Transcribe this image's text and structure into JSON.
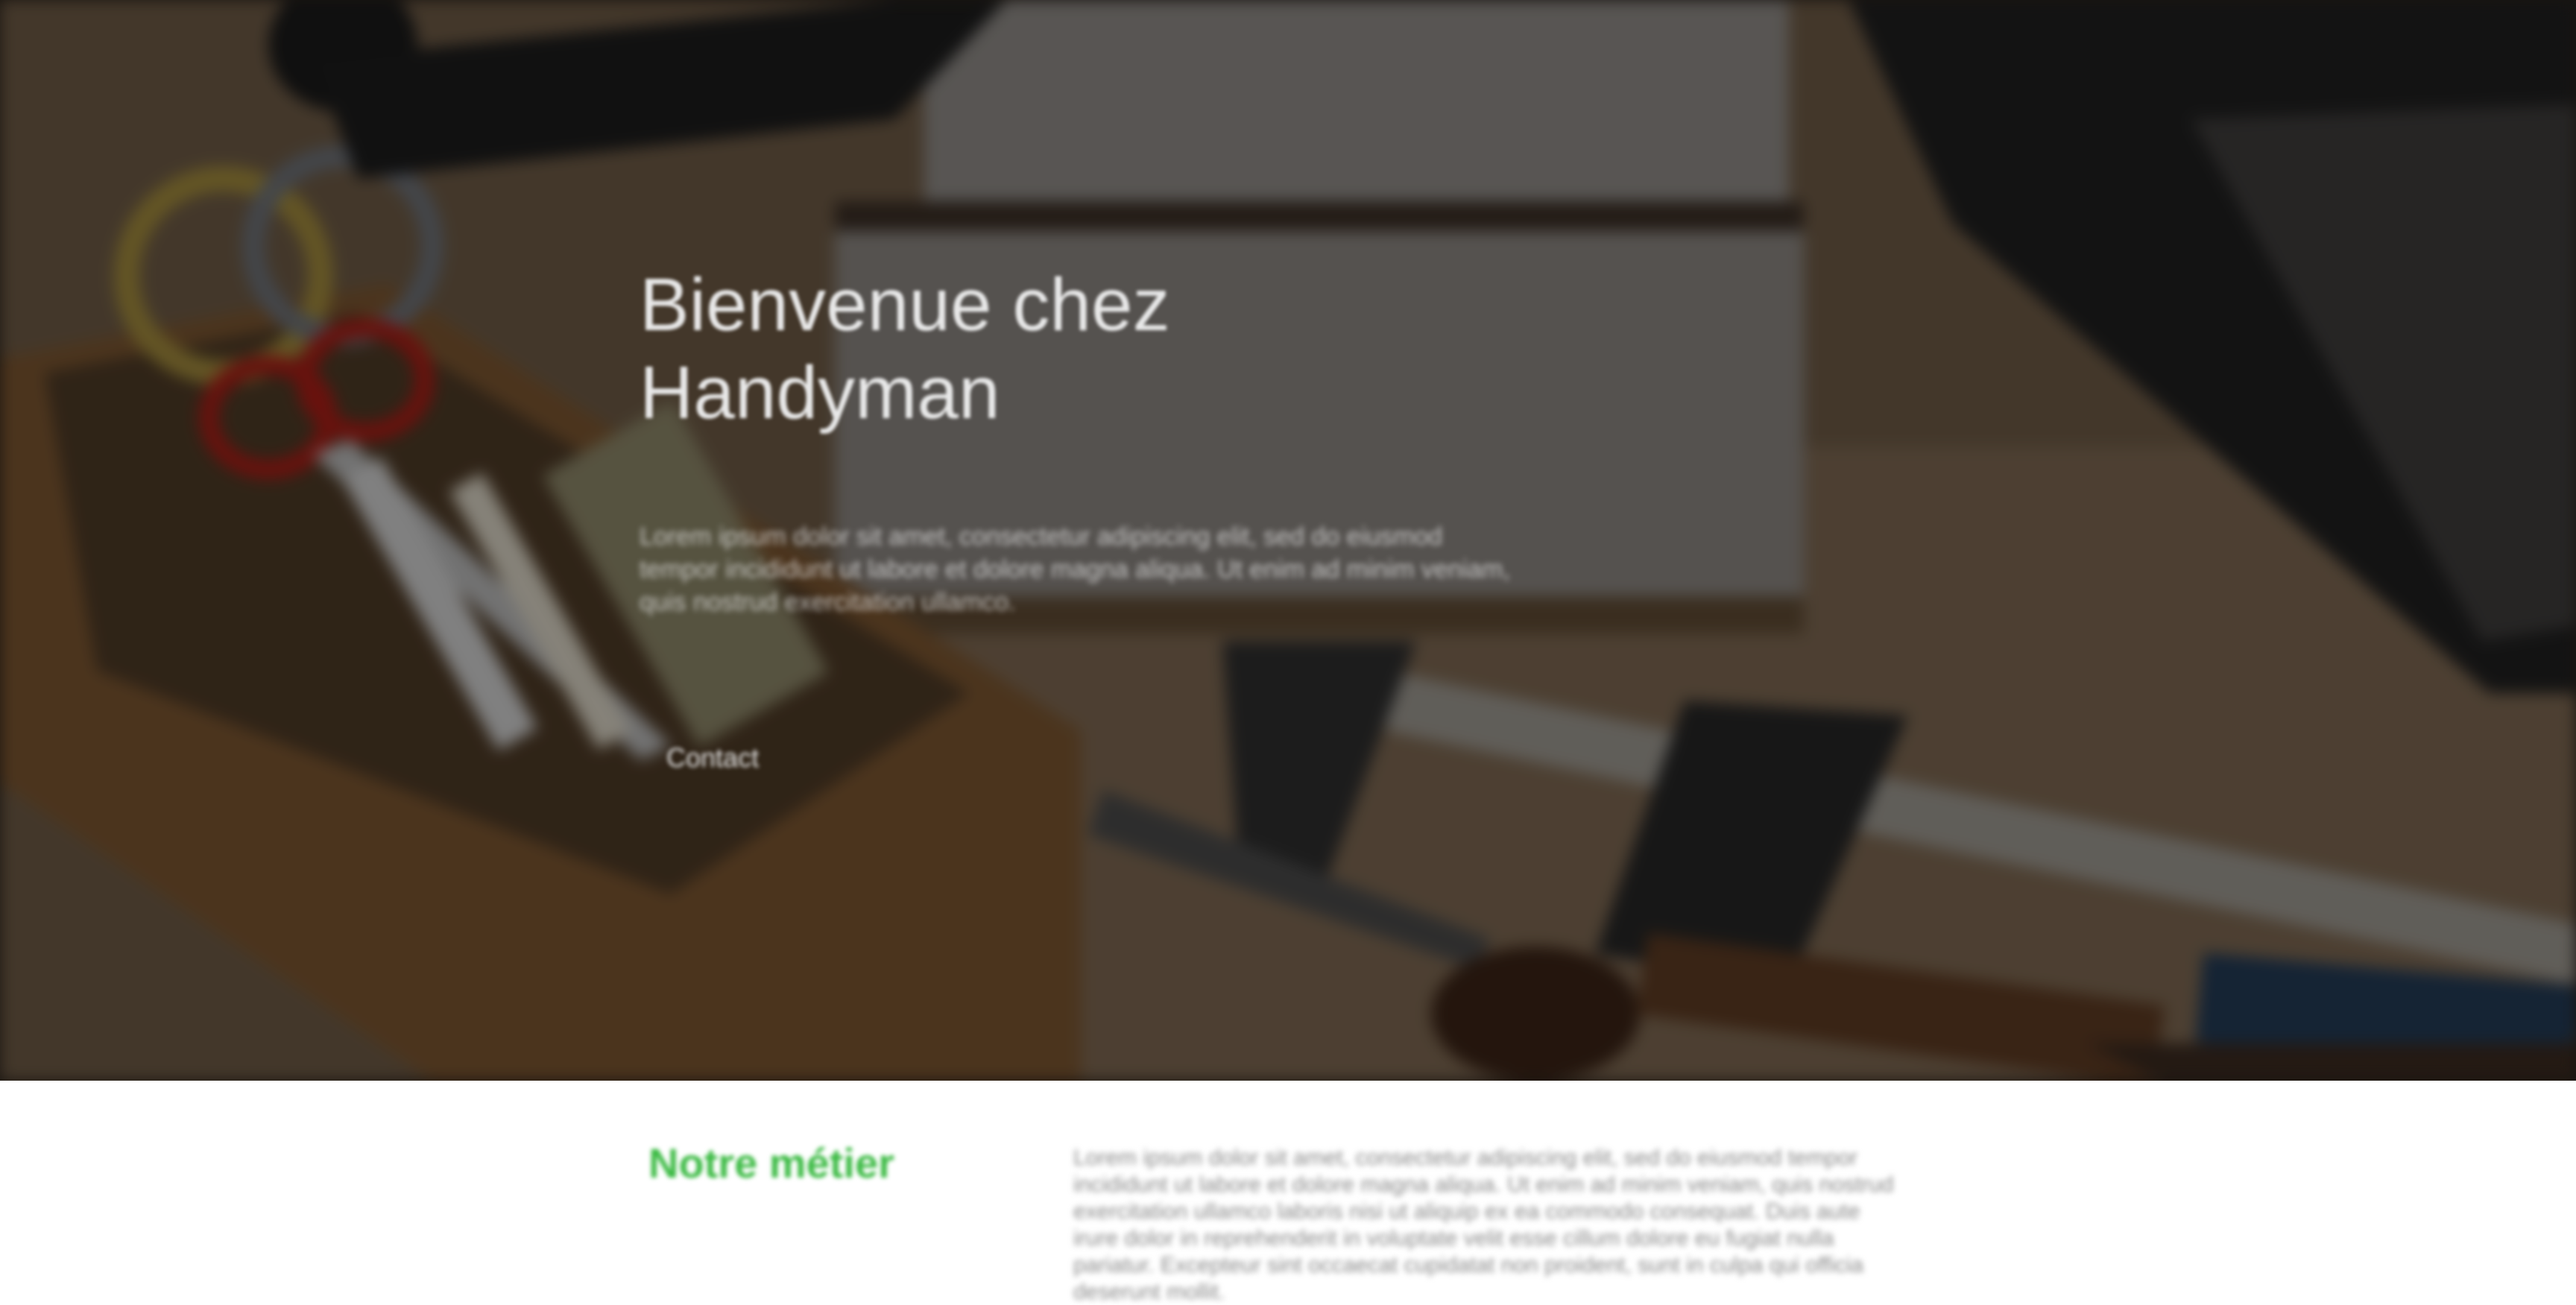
{
  "hero": {
    "title": "Bienvenue chez Handyman",
    "text": "Lorem ipsum dolor sit amet, consectetur adipiscing elit, sed do eiusmod tempor incididunt ut labore et dolore magna aliqua. Ut enim ad minim veniam, quis nostrud exercitation ullamco.",
    "button_label": "Contact"
  },
  "metier": {
    "title": "Notre métier",
    "text": "Lorem ipsum dolor sit amet, consectetur adipiscing elit, sed do eiusmod tempor incididunt ut labore et dolore magna aliqua. Ut enim ad minim veniam, quis nostrud exercitation ullamco laboris nisi ut aliquip ex ea commodo consequat. Duis aute irure dolor in reprehenderit in voluptate velit esse cillum dolore eu fugiat nulla pariatur. Excepteur sint occaecat cupidatat non proident, sunt in culpa qui officia deserunt mollit."
  },
  "colors": {
    "accent": "#3dbb45",
    "hero_overlay": "rgba(0,0,0,0.38)",
    "body_text": "#8a8a8a"
  }
}
